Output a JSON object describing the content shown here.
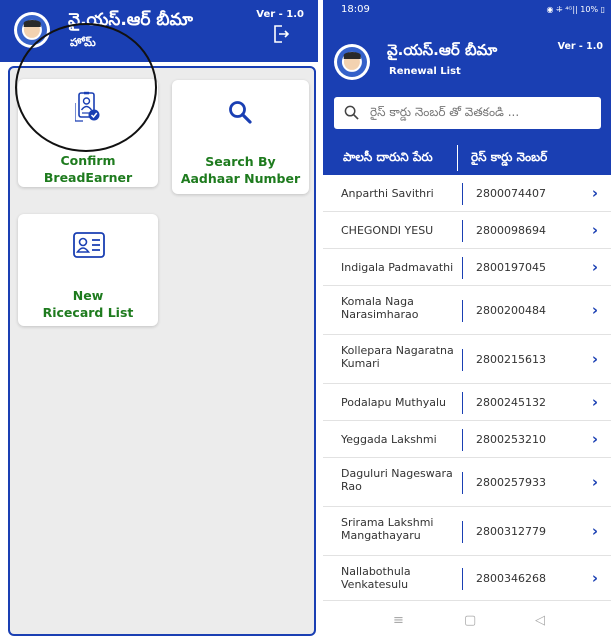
{
  "left": {
    "header": {
      "title": "వై.యస్.ఆర్ బీమా",
      "subtitle": "హోమ్",
      "version": "Ver - 1.0"
    },
    "cards": [
      {
        "label_line1": "Confirm",
        "label_line2": "BreadEarner",
        "icon": "id-card-check-icon"
      },
      {
        "label_line1": "Search By",
        "label_line2": "Aadhaar Number",
        "icon": "search-icon"
      },
      {
        "label_line1": "New",
        "label_line2": "Ricecard List",
        "icon": "contact-card-icon"
      }
    ]
  },
  "right": {
    "status": {
      "time": "18:09",
      "icons": "◉ ⁜ ⁴ᴳ|| 10% ▯"
    },
    "header": {
      "title": "వై.యస్.ఆర్ బీమా",
      "subtitle": "Renewal List",
      "version": "Ver - 1.0"
    },
    "search": {
      "placeholder": "రైస్ కార్డు నెంబర్ తో వెతకండి ..."
    },
    "table": {
      "headers": [
        "పాలసీ దారుని పేరు",
        "రైస్ కార్డు నెంబర్"
      ],
      "rows": [
        {
          "name": "Anparthi Savithri",
          "number": "2800074407"
        },
        {
          "name": "CHEGONDI YESU",
          "number": "2800098694"
        },
        {
          "name": "Indigala Padmavathi",
          "number": "2800197045"
        },
        {
          "name": "Komala Naga Narasimharao",
          "number": "2800200484"
        },
        {
          "name": "Kollepara Nagaratna Kumari",
          "number": "2800215613"
        },
        {
          "name": "Podalapu Muthyalu",
          "number": "2800245132"
        },
        {
          "name": "Yeggada Lakshmi",
          "number": "2800253210"
        },
        {
          "name": "Daguluri Nageswara Rao",
          "number": "2800257933"
        },
        {
          "name": "Srirama Lakshmi Mangathayaru",
          "number": "2800312779"
        },
        {
          "name": "Nallabothula Venkatesulu",
          "number": "2800346268"
        }
      ]
    },
    "navbar": {
      "menu": "≡",
      "home": "▢",
      "back": "◁"
    }
  },
  "colors": {
    "primary": "#1a3fb3",
    "card_text": "#1e7b1e",
    "background": "#ececec"
  }
}
